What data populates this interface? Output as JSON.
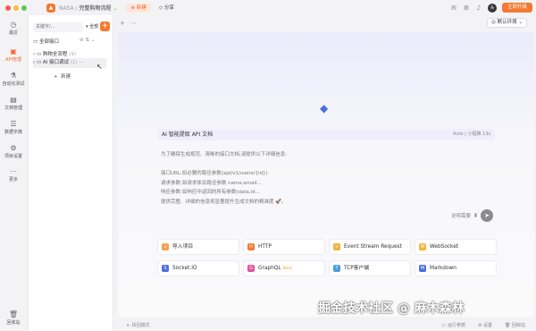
{
  "titlebar": {
    "crumb_app": "NASA",
    "crumb_sep": "/",
    "project": "完整购物流程",
    "new_label": "新建",
    "share_label": "分享",
    "upgrade_label": "立即升级",
    "avatar_letter": "头"
  },
  "leftnav": {
    "items": [
      {
        "label": "最近",
        "icon": "clock-icon"
      },
      {
        "label": "API管理",
        "icon": "api-icon"
      },
      {
        "label": "自动化测试",
        "icon": "flask-icon"
      },
      {
        "label": "文档管理",
        "icon": "doc-icon"
      },
      {
        "label": "数据字典",
        "icon": "book-icon"
      },
      {
        "label": "项目设置",
        "icon": "gear-icon"
      },
      {
        "label": "更多",
        "icon": "more-icon"
      },
      {
        "label": "回收站",
        "icon": "trash-icon"
      }
    ]
  },
  "tree": {
    "search_placeholder": "关键字/...",
    "filter_label": "全部",
    "root_label": "全部接口",
    "items": [
      {
        "label": "购物全流程",
        "count": "(9)"
      },
      {
        "label": "AI 接口调试",
        "count": "(1)"
      }
    ],
    "new_label": "新建"
  },
  "main": {
    "env_label": "默认环境",
    "ai_title": "AI 智能提取 API 文档",
    "ai_meta": "Auto  |  小程推  13s",
    "ai_intro": "为了确保生成规范、清晰的接口文档,请提供以下详细信息:",
    "ai_lines": [
      "接口URL:如必要的路径参数(api/v1/users/{id})",
      "请求参数:如请求体及路径参数 name,email...",
      "响应参数:如响应中返回的所有参数(data,id...",
      "提供完整、详细的信息将显著提升生成文档的精准度 🚀。"
    ],
    "ai_hint": "说明需要",
    "cards": [
      {
        "label": "导入项目",
        "icon": "import-icon",
        "color": "#f5a04a"
      },
      {
        "label": "HTTP",
        "icon": "http-icon",
        "color": "#f27a32"
      },
      {
        "label": "Event Stream Request",
        "icon": "stream-icon",
        "color": "#f0b43a"
      },
      {
        "label": "WebSocket",
        "icon": "websocket-icon",
        "color": "#f0b43a"
      },
      {
        "label": "Socket.IO",
        "icon": "socketio-icon",
        "color": "#4a6ee0"
      },
      {
        "label": "GraphQL",
        "icon": "graphql-icon",
        "color": "#e2539b",
        "badge": "Beta"
      },
      {
        "label": "TCP客户端",
        "icon": "tcp-icon",
        "color": "#4a9ee0"
      },
      {
        "label": "Markdown",
        "icon": "markdown-icon",
        "color": "#4a6ee0"
      }
    ],
    "bottom_left": "拆回模式",
    "bottom_right": [
      "运行参数",
      "设置",
      "回收站"
    ]
  },
  "watermark": "掘金技术社区 @ 麻木森林"
}
